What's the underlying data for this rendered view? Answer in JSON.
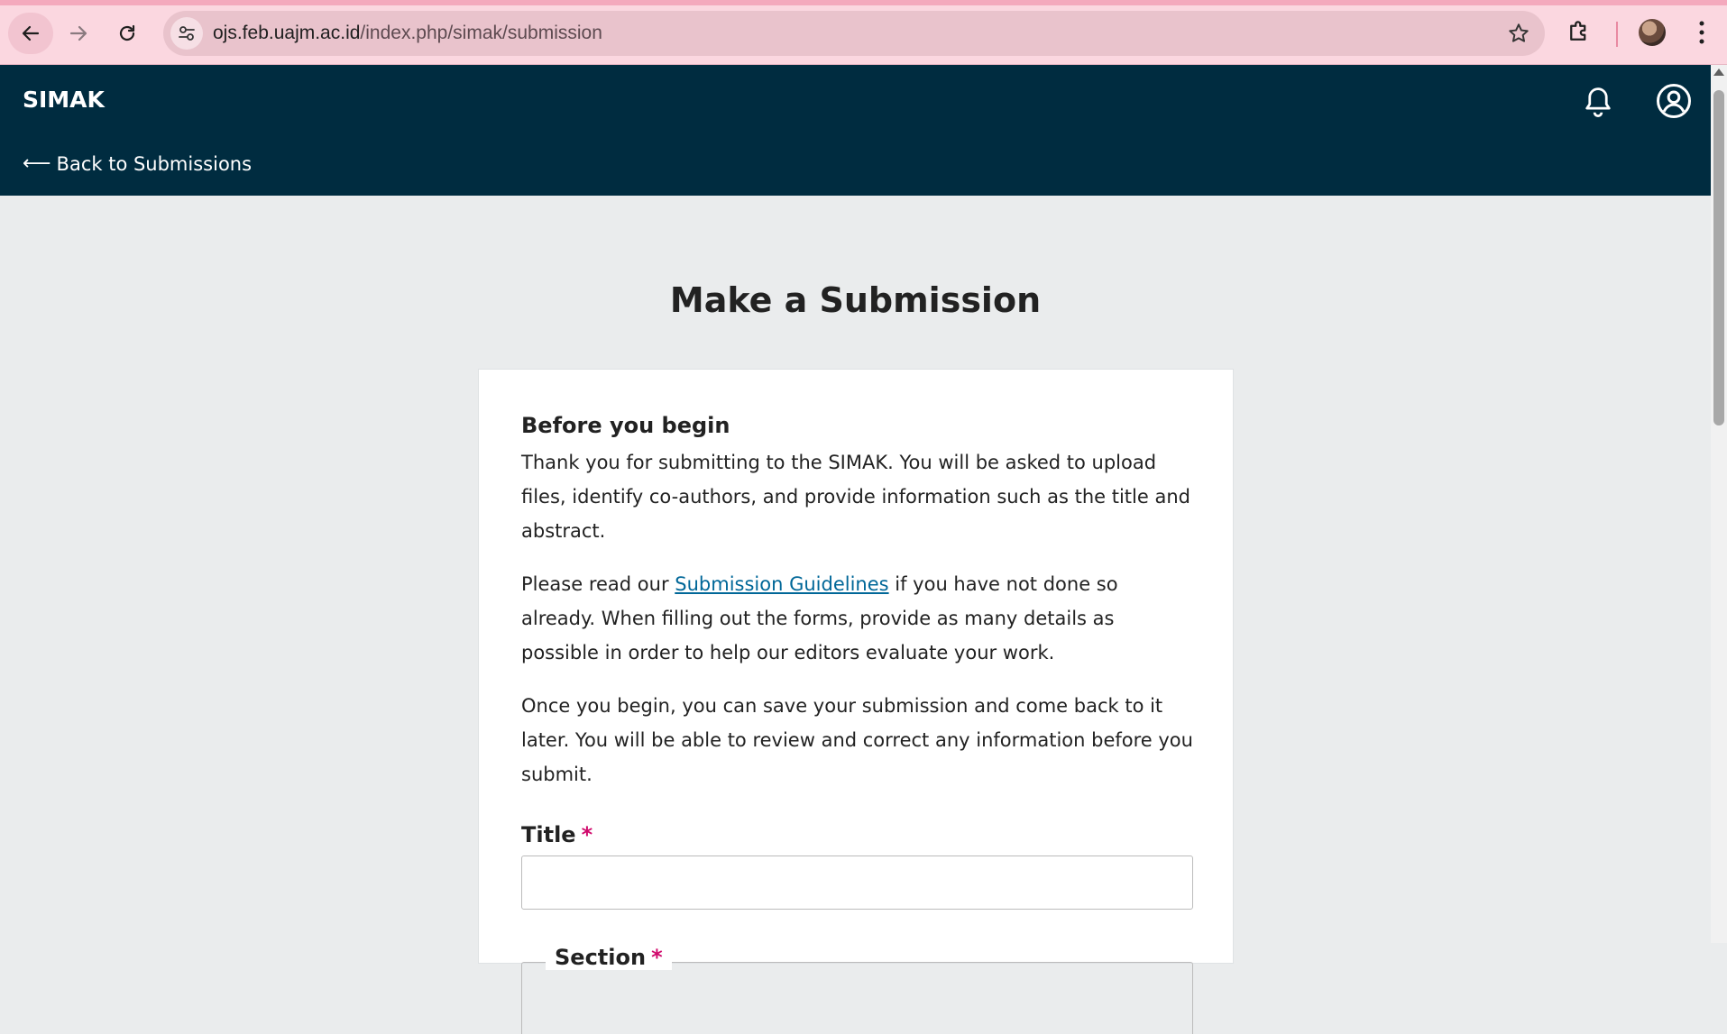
{
  "browser": {
    "url_host": "ojs.feb.uajm.ac.id",
    "url_path": "/index.php/simak/submission"
  },
  "header": {
    "brand": "SIMAK",
    "back_label": "Back to Submissions",
    "back_arrow": "⟵"
  },
  "main": {
    "page_title": "Make a Submission",
    "intro_heading": "Before you begin",
    "para1": "Thank you for submitting to the SIMAK. You will be asked to upload files, identify co-authors, and provide information such as the title and abstract.",
    "para2_before": "Please read our ",
    "para2_link": "Submission Guidelines",
    "para2_after": " if you have not done so already. When filling out the forms, provide as many details as possible in order to help our editors evaluate your work.",
    "para3": "Once you begin, you can save your submission and come back to it later. You will be able to review and correct any information before you submit.",
    "title_label": "Title",
    "title_value": "",
    "section_label": "Section",
    "required_mark": "*"
  },
  "icons": {
    "back": "arrow-left-icon",
    "forward": "arrow-right-icon",
    "reload": "reload-icon",
    "site_info": "tune-icon",
    "bookmark": "star-icon",
    "extensions": "puzzle-icon",
    "menu": "vertical-dots-icon",
    "notifications": "bell-icon",
    "account": "user-circle-icon"
  },
  "colors": {
    "header_bg": "#002c40",
    "link": "#006798",
    "required": "#d00a6c",
    "chrome_bg": "#fbd7e0"
  }
}
